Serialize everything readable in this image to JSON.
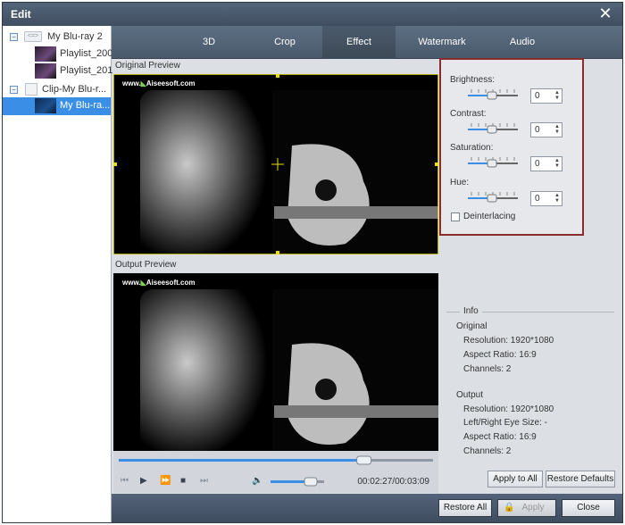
{
  "window": {
    "title": "Edit"
  },
  "tree": [
    {
      "label": "My Blu-ray 2"
    },
    {
      "label": "Playlist_200"
    },
    {
      "label": "Playlist_201"
    },
    {
      "label": "Clip-My Blu-r..."
    },
    {
      "label": "My Blu-ra..."
    }
  ],
  "tabs": [
    "3D",
    "Crop",
    "Effect",
    "Watermark",
    "Audio"
  ],
  "preview": {
    "original_label": "Original Preview",
    "output_label": "Output Preview",
    "watermark_prefix": "www.",
    "watermark_brand": "Aisee",
    "watermark_suffix": "soft.com"
  },
  "effect": {
    "brightness_label": "Brightness:",
    "brightness_value": "0",
    "contrast_label": "Contrast:",
    "contrast_value": "0",
    "saturation_label": "Saturation:",
    "saturation_value": "0",
    "hue_label": "Hue:",
    "hue_value": "0",
    "deinterlacing_label": "Deinterlacing"
  },
  "info": {
    "title": "Info",
    "original_heading": "Original",
    "original_resolution": "Resolution: 1920*1080",
    "original_aspect": "Aspect Ratio: 16:9",
    "original_channels": "Channels: 2",
    "output_heading": "Output",
    "output_resolution": "Resolution: 1920*1080",
    "output_eye": "Left/Right Eye Size: -",
    "output_aspect": "Aspect Ratio: 16:9",
    "output_channels": "Channels: 2"
  },
  "buttons": {
    "apply_all": "Apply to All",
    "restore_defaults": "Restore Defaults",
    "restore_all": "Restore All",
    "apply": "Apply",
    "close": "Close"
  },
  "playback": {
    "time": "00:02:27/00:03:09",
    "progress": 0.78,
    "volume": 0.75
  },
  "colors": {
    "accent_blue": "#3a8ee6",
    "highlight_red": "#8b2c2c",
    "crop_yellow": "#e8e000"
  }
}
